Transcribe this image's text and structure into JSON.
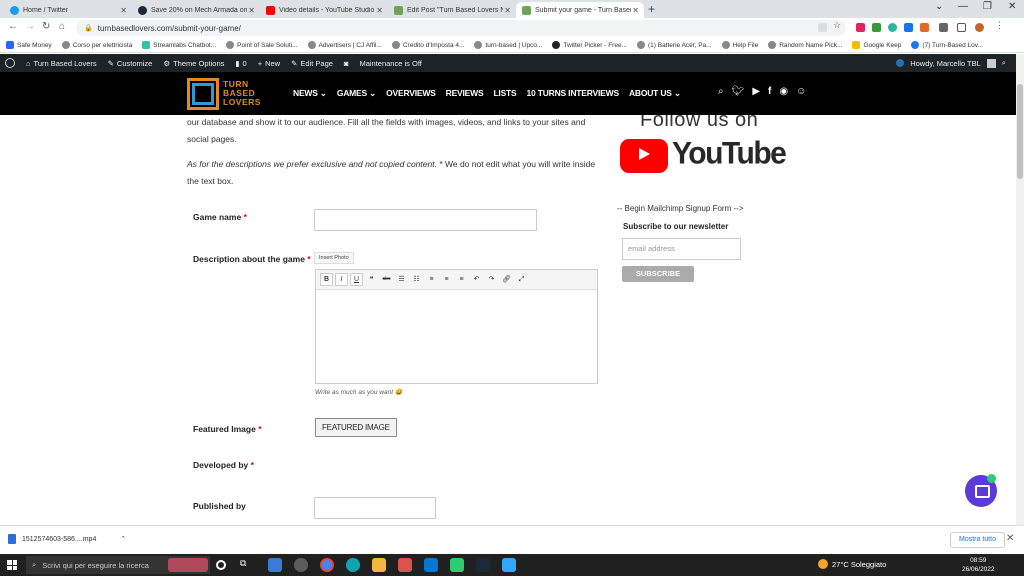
{
  "browser": {
    "tabs": [
      {
        "title": "Home / Twitter",
        "color": "#1d9bf0"
      },
      {
        "title": "Save 20% on Mech Armada on S",
        "color": "#1b2838"
      },
      {
        "title": "Video details - YouTube Studio",
        "color": "#ff0000"
      },
      {
        "title": "Edit Post \"Turn Based Lovers Ne",
        "color": "#6fa35a"
      },
      {
        "title": "Submit your game - Turn Based",
        "color": "#6fa35a"
      }
    ],
    "url": "turnbasedlovers.com/submit-your-game/",
    "bookmarks": [
      "Safe Money",
      "Corso per elettricista",
      "Streamlabs Chatbot...",
      "Point of Sale Soluti...",
      "Advertisers | CJ Affil...",
      "Credito d'Imposta 4...",
      "turn-based | Upco...",
      "Twitter Picker - Free...",
      "(1) Batterie Acer, Pa...",
      "Help File",
      "Random Name Pick...",
      "Google Keep",
      "(7) Turn-Based Lov..."
    ]
  },
  "wpbar": {
    "site": "Turn Based Lovers",
    "customize": "Customize",
    "theme_options": "Theme Options",
    "comments": "0",
    "new": "New",
    "edit_page": "Edit Page",
    "maintenance": "Maintenance is Off",
    "howdy": "Howdy, Marcello TBL"
  },
  "site": {
    "logo_lines": [
      "TURN",
      "BASED",
      "LOVERS"
    ],
    "menu": [
      "NEWS",
      "GAMES",
      "OVERVIEWS",
      "REVIEWS",
      "LISTS",
      "10 TURNS INTERVIEWS",
      "ABOUT US"
    ]
  },
  "form": {
    "intro": "our database and show it to our audience. Fill all the fields with images, videos, and links to your sites and social pages.",
    "desc_note_italic": "As for the descriptions we prefer exclusive and not copied content.",
    "desc_note_rest": " * We do not edit what you will write inside the text box.",
    "game_name_label": "Game name",
    "description_label": "Description about the game",
    "insert_photo": "Insert Photo",
    "hint": "Write as much as you want 😀",
    "featured_image_label": "Featured Image",
    "featured_image_button": "FEATURED IMAGE",
    "developed_by_label": "Developed by",
    "published_by_label": "Published by",
    "required_mark": "*"
  },
  "sidebar": {
    "follow_us": "Follow us on",
    "youtube_word": "YouTube",
    "mailchimp_comment": "-- Begin Mailchimp Signup Form -->",
    "newsletter_title": "Subscribe to our newsletter",
    "email_placeholder": "email address",
    "subscribe_label": "SUBSCRIBE"
  },
  "downloads": {
    "file": "1512574603-586....mp4",
    "show_all": "Mostra tutto"
  },
  "taskbar": {
    "search_placeholder": "Scrivi qui per eseguire la ricerca",
    "weather": "27°C  Soleggiato",
    "time": "08:59",
    "date": "26/06/2022"
  }
}
